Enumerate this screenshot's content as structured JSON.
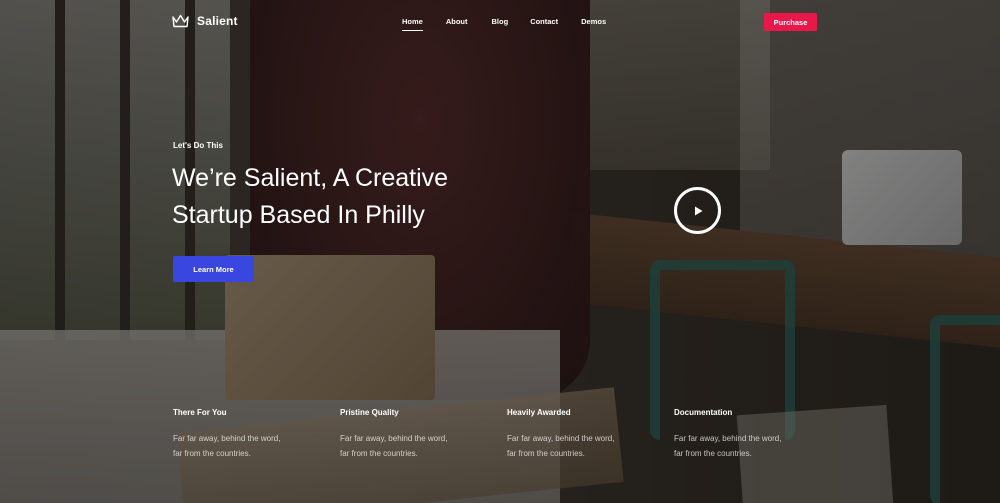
{
  "header": {
    "brand": "Salient",
    "nav": [
      "Home",
      "About",
      "Blog",
      "Contact",
      "Demos"
    ],
    "active_nav": "Home",
    "purchase_label": "Purchase"
  },
  "hero": {
    "eyebrow": "Let's Do This",
    "title_line1": "We’re Salient, A Creative",
    "title_line2": "Startup Based In Philly",
    "cta_label": "Learn More"
  },
  "features": [
    {
      "title": "There For You",
      "line1": "Far far away, behind the word,",
      "line2": "far from the countries."
    },
    {
      "title": "Pristine Quality",
      "line1": "Far far away, behind the word,",
      "line2": "far from the countries."
    },
    {
      "title": "Heavily Awarded",
      "line1": "Far far away, behind the word,",
      "line2": "far from the countries."
    },
    {
      "title": "Documentation",
      "line1": "Far far away, behind the word,",
      "line2": "far from the countries."
    }
  ],
  "colors": {
    "accent_purchase": "#e8184a",
    "accent_cta": "#3a46e0"
  },
  "icons": {
    "logo": "crown-icon",
    "video": "play-icon"
  }
}
